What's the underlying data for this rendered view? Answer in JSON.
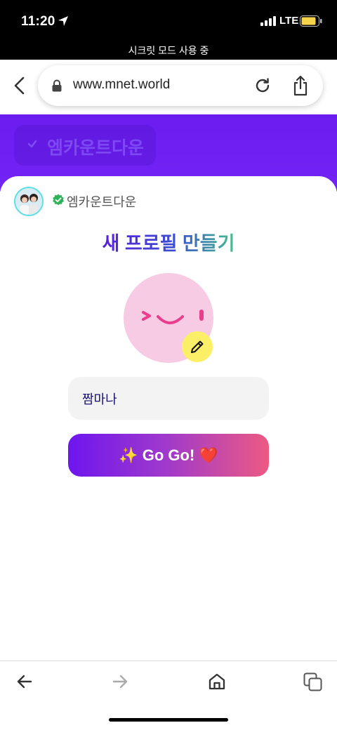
{
  "status_bar": {
    "time": "11:20",
    "network": "LTE"
  },
  "browser": {
    "private_mode_text": "시크릿 모드 사용 중",
    "url": "www.mnet.world"
  },
  "background_page": {
    "tag_label": "엠카운트다운"
  },
  "sheet": {
    "channel_name": "엠카운트다운",
    "title": "새 프로필 만들기",
    "name_input_value": "짬마나",
    "go_button_label": "✨ Go Go! ❤️"
  },
  "colors": {
    "brand_purple": "#6b1df0",
    "face_pink": "#f6cbe3",
    "edit_yellow": "#fcef68",
    "gradient_start": "#6d16ef",
    "gradient_end": "#ec5a82"
  },
  "icons": [
    "location-arrow-icon",
    "signal-icon",
    "battery-icon",
    "back-icon",
    "lock-icon",
    "reload-icon",
    "share-icon",
    "verified-check-icon",
    "pencil-icon",
    "arrow-left-icon",
    "arrow-right-icon",
    "home-icon",
    "tabs-icon"
  ]
}
